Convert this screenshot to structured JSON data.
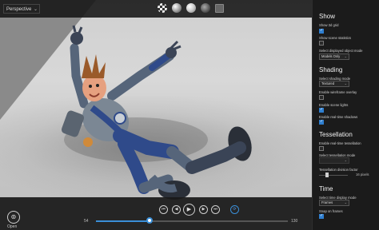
{
  "viewport": {
    "camera_mode": "Perspective",
    "shading_buttons": [
      "checker-icon",
      "sphere-icon",
      "sphere-glossy-icon",
      "sphere-dark-icon",
      "square-icon"
    ]
  },
  "bottom_bar": {
    "open_label": "Open",
    "start_frame": "54",
    "end_frame": "130",
    "playback_position": 0.28,
    "controls": [
      "skip-back-icon",
      "step-back-icon",
      "play-icon",
      "step-forward-icon",
      "skip-forward-icon",
      "loop-icon"
    ]
  },
  "panel": {
    "show": {
      "title": "Show",
      "show_3d_grid": "Show 3d grid",
      "show_scene_statistics": "Show scene statistics",
      "display_mode_label": "Select displayed object mode",
      "display_mode_value": "Models Only"
    },
    "shading": {
      "title": "Shading",
      "mode_label": "Select shading mode",
      "mode_value": "Textured",
      "wireframe_label": "Enable wireframe overlay",
      "scene_lights_label": "Enable scene lights",
      "realtime_shadows_label": "Enable real-time shadows"
    },
    "tessellation": {
      "title": "Tessellation",
      "enable_label": "Enable real-time tessellation",
      "mode_label": "Select tessellation mode",
      "mode_value": "",
      "division_label": "Tessellation division factor",
      "division_value": "16 pixels"
    },
    "time": {
      "title": "Time",
      "display_mode_label": "Select time display mode",
      "display_mode_value": "Frames",
      "snap_label": "Snap on frames"
    }
  },
  "colors": {
    "accent": "#2f7fd0",
    "panel_bg": "#1b1b1b",
    "suit_blue": "#2f4a8a",
    "suit_grey": "#8a949e"
  }
}
